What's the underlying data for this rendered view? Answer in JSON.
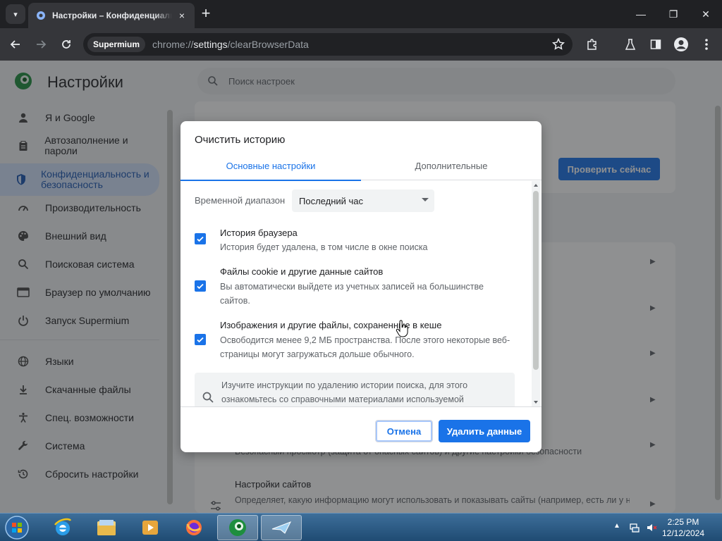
{
  "browser": {
    "tab_title": "Настройки – Конфиденциальность и безопасность",
    "tab_close": "×",
    "new_tab": "+",
    "window_controls": {
      "minimize": "—",
      "maximize": "❐",
      "close": "✕"
    },
    "omnibox": {
      "chip": "Supermium",
      "url_prefix": "chrome://",
      "url_host": "settings",
      "url_path": "/clearBrowserData"
    }
  },
  "settings": {
    "title": "Настройки",
    "search_placeholder": "Поиск настроек",
    "nav": [
      {
        "label": "Я и Google",
        "icon": "person-icon"
      },
      {
        "label": "Автозаполнение и пароли",
        "icon": "clipboard-icon"
      },
      {
        "label": "Конфиденциальность и безопасность",
        "icon": "shield-icon",
        "active": true
      },
      {
        "label": "Производительность",
        "icon": "gauge-icon"
      },
      {
        "label": "Внешний вид",
        "icon": "palette-icon"
      },
      {
        "label": "Поисковая система",
        "icon": "search-icon"
      },
      {
        "label": "Браузер по умолчанию",
        "icon": "browser-window-icon"
      },
      {
        "label": "Запуск Supermium",
        "icon": "power-icon"
      },
      {
        "label": "Языки",
        "icon": "globe-icon"
      },
      {
        "label": "Скачанные файлы",
        "icon": "download-icon"
      },
      {
        "label": "Спец. возможности",
        "icon": "accessibility-icon"
      },
      {
        "label": "Система",
        "icon": "wrench-icon"
      },
      {
        "label": "Сбросить настройки",
        "icon": "history-icon"
      }
    ],
    "check_now_button": "Проверить сейчас",
    "safe_browsing_desc": "Безопасный просмотр (защита от опасных сайтов) и другие настройки безопасности",
    "site_settings": {
      "title": "Настройки сайтов",
      "desc": "Определяет, какую информацию могут использовать и показывать сайты (например, есть ли у них доступ к местоположению и камере, а также разрешение на показ всплывающих окон"
    }
  },
  "dialog": {
    "title": "Очистить историю",
    "tabs": [
      "Основные настройки",
      "Дополнительные"
    ],
    "time_range_label": "Временной диапазон",
    "time_range_value": "Последний час",
    "options": [
      {
        "title": "История браузера",
        "desc": "История будет удалена, в том числе в окне поиска",
        "checked": true
      },
      {
        "title": "Файлы cookie и другие данные сайтов",
        "desc": "Вы автоматически выйдете из учетных записей на большинстве сайтов.",
        "checked": true
      },
      {
        "title": "Изображения и другие файлы, сохраненные в кеше",
        "desc": "Освободится менее 9,2 МБ пространства. После этого некоторые веб-страницы могут загружаться дольше обычного.",
        "checked": true
      }
    ],
    "info_text": "Изучите инструкции по удалению истории поиска, для этого ознакомьтесь со справочными материалами используемой",
    "cancel_button": "Отмена",
    "delete_button": "Удалить данные"
  },
  "taskbar": {
    "time": "2:25 PM",
    "date": "12/12/2024"
  },
  "colors": {
    "accent": "#1a73e8",
    "active_nav_bg": "#d3e3fd",
    "chrome_dark": "#202124"
  }
}
